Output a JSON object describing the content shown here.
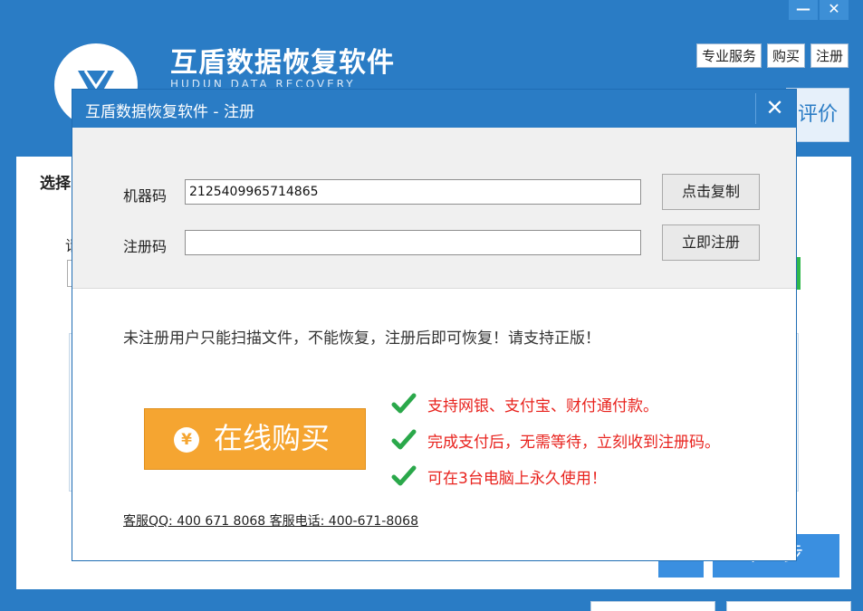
{
  "app": {
    "title": "互盾数据恢复软件",
    "subtitle": "HUDUN DATA RECOVERY",
    "window_minimize": "—",
    "window_close": "✕",
    "top_links": [
      "专业服务",
      "购买",
      "注册"
    ],
    "rate_button": "评价",
    "panel_heading": "选择",
    "panel_label": "请",
    "next_button": "下一步"
  },
  "dialog": {
    "title": "互盾数据恢复软件 - 注册",
    "close": "✕",
    "machine_label": "机器码",
    "machine_value": "2125409965714865",
    "copy_button": "点击复制",
    "reg_label": "注册码",
    "reg_value": "",
    "register_button": "立即注册",
    "notice": "未注册用户只能扫描文件，不能恢复，注册后即可恢复！请支持正版！",
    "buy_button": "在线购买",
    "buy_icon": "¥",
    "features": [
      "支持网银、支付宝、财付通付款。",
      "完成支付后，无需等待，立刻收到注册码。",
      "可在3台电脑上永久使用！"
    ],
    "contact": "客服QQ: 400 671 8068 客服电话: 400-671-8068"
  },
  "colors": {
    "titlebar": "#2a7cc5",
    "buy_button": "#f5a531",
    "feature_text": "#e8231e",
    "check": "#2aa84a"
  }
}
